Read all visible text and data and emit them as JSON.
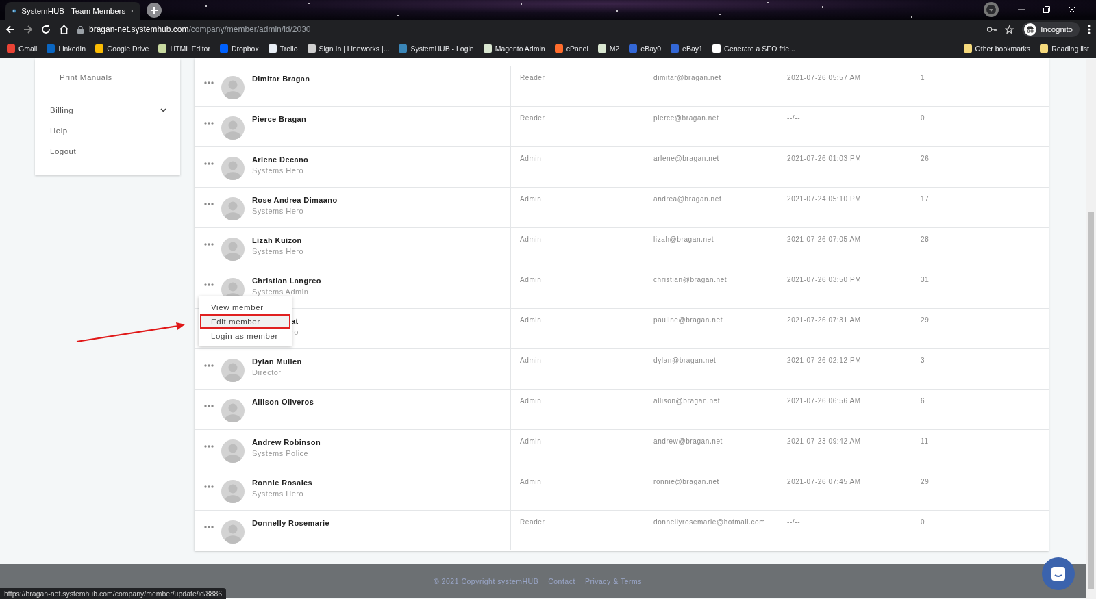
{
  "browser": {
    "tabs": [
      {
        "title": "SystemHUB - Team Members",
        "selected": true
      }
    ],
    "url_host": "bragan-net.systemhub.com",
    "url_path": "/company/member/admin/id/2030",
    "profile": "Incognito",
    "bookmarks": [
      {
        "label": "Gmail",
        "color": "#ea4335"
      },
      {
        "label": "LinkedIn",
        "color": "#0a66c2"
      },
      {
        "label": "Google Drive",
        "color": "#fbbc04"
      },
      {
        "label": "HTML Editor",
        "color": "#c8d9a0"
      },
      {
        "label": "Dropbox",
        "color": "#0061fe"
      },
      {
        "label": "Trello",
        "color": "#e8eef5"
      },
      {
        "label": "Sign In | Linnworks |...",
        "color": "#cfcfcf"
      },
      {
        "label": "SystemHUB - Login",
        "color": "#3a86b8"
      },
      {
        "label": "Magento Admin",
        "color": "#d9e6d0"
      },
      {
        "label": "cPanel",
        "color": "#ff6c2c"
      },
      {
        "label": "M2",
        "color": "#d9e6d0"
      },
      {
        "label": "eBay0",
        "color": "#3367d6"
      },
      {
        "label": "eBay1",
        "color": "#3367d6"
      },
      {
        "label": "Generate a SEO frie...",
        "color": "#ffffff"
      }
    ],
    "bookmarks_right": [
      "Other bookmarks",
      "Reading list"
    ]
  },
  "sidebar": {
    "items": [
      {
        "label": "Print Manuals",
        "kind": "sub"
      },
      {
        "label": "Billing",
        "kind": "group"
      },
      {
        "label": "Help",
        "kind": "link"
      },
      {
        "label": "Logout",
        "kind": "link"
      }
    ]
  },
  "members": [
    {
      "name": "Dimitar Bragan",
      "role": "Reader",
      "email": "dimitar@bragan.net",
      "last_login": "2021-07-26 05:57 AM",
      "count": "1"
    },
    {
      "name": "Pierce Bragan",
      "role": "Reader",
      "email": "pierce@bragan.net",
      "last_login": "--/--",
      "count": "0"
    },
    {
      "name": "Arlene Decano",
      "title": "Systems Hero",
      "role": "Admin",
      "email": "arlene@bragan.net",
      "last_login": "2021-07-26 01:03 PM",
      "count": "26"
    },
    {
      "name": "Rose Andrea Dimaano",
      "title": "Systems Hero",
      "role": "Admin",
      "email": "andrea@bragan.net",
      "last_login": "2021-07-24 05:10 PM",
      "count": "17"
    },
    {
      "name": "Lizah Kuizon",
      "title": "Systems Hero",
      "role": "Admin",
      "email": "lizah@bragan.net",
      "last_login": "2021-07-26 07:05 AM",
      "count": "28"
    },
    {
      "name": "Christian Langreo",
      "title": "Systems Admin",
      "role": "Admin",
      "email": "christian@bragan.net",
      "last_login": "2021-07-26 03:50 PM",
      "count": "31",
      "menu": [
        {
          "label": "View member",
          "selected": false
        },
        {
          "label": "Edit member",
          "selected": true
        },
        {
          "label": "Login as member",
          "selected": false
        }
      ]
    },
    {
      "name": "at",
      "title": "ro",
      "partial": true,
      "role": "Admin",
      "email": "pauline@bragan.net",
      "last_login": "2021-07-26 07:31 AM",
      "count": "29"
    },
    {
      "name": "Dylan Mullen",
      "title": "Director",
      "role": "Admin",
      "email": "dylan@bragan.net",
      "last_login": "2021-07-26 02:12 PM",
      "count": "3"
    },
    {
      "name": "Allison Oliveros",
      "role": "Admin",
      "email": "allison@bragan.net",
      "last_login": "2021-07-26 06:56 AM",
      "count": "6"
    },
    {
      "name": "Andrew Robinson",
      "title": "Systems Police",
      "role": "Admin",
      "email": "andrew@bragan.net",
      "last_login": "2021-07-23 09:42 AM",
      "count": "11"
    },
    {
      "name": "Ronnie Rosales",
      "title": "Systems Hero",
      "role": "Admin",
      "email": "ronnie@bragan.net",
      "last_login": "2021-07-26 07:45 AM",
      "count": "29"
    },
    {
      "name": "Donnelly Rosemarie",
      "role": "Reader",
      "email": "donnellyrosemarie@hotmail.com",
      "last_login": "--/--",
      "count": "0"
    }
  ],
  "footer": {
    "copyright": "© 2021 Copyright systemHUB",
    "links": [
      "Contact",
      "Privacy & Terms"
    ]
  },
  "status_url": "https://bragan-net.systemhub.com/company/member/update/id/8886"
}
